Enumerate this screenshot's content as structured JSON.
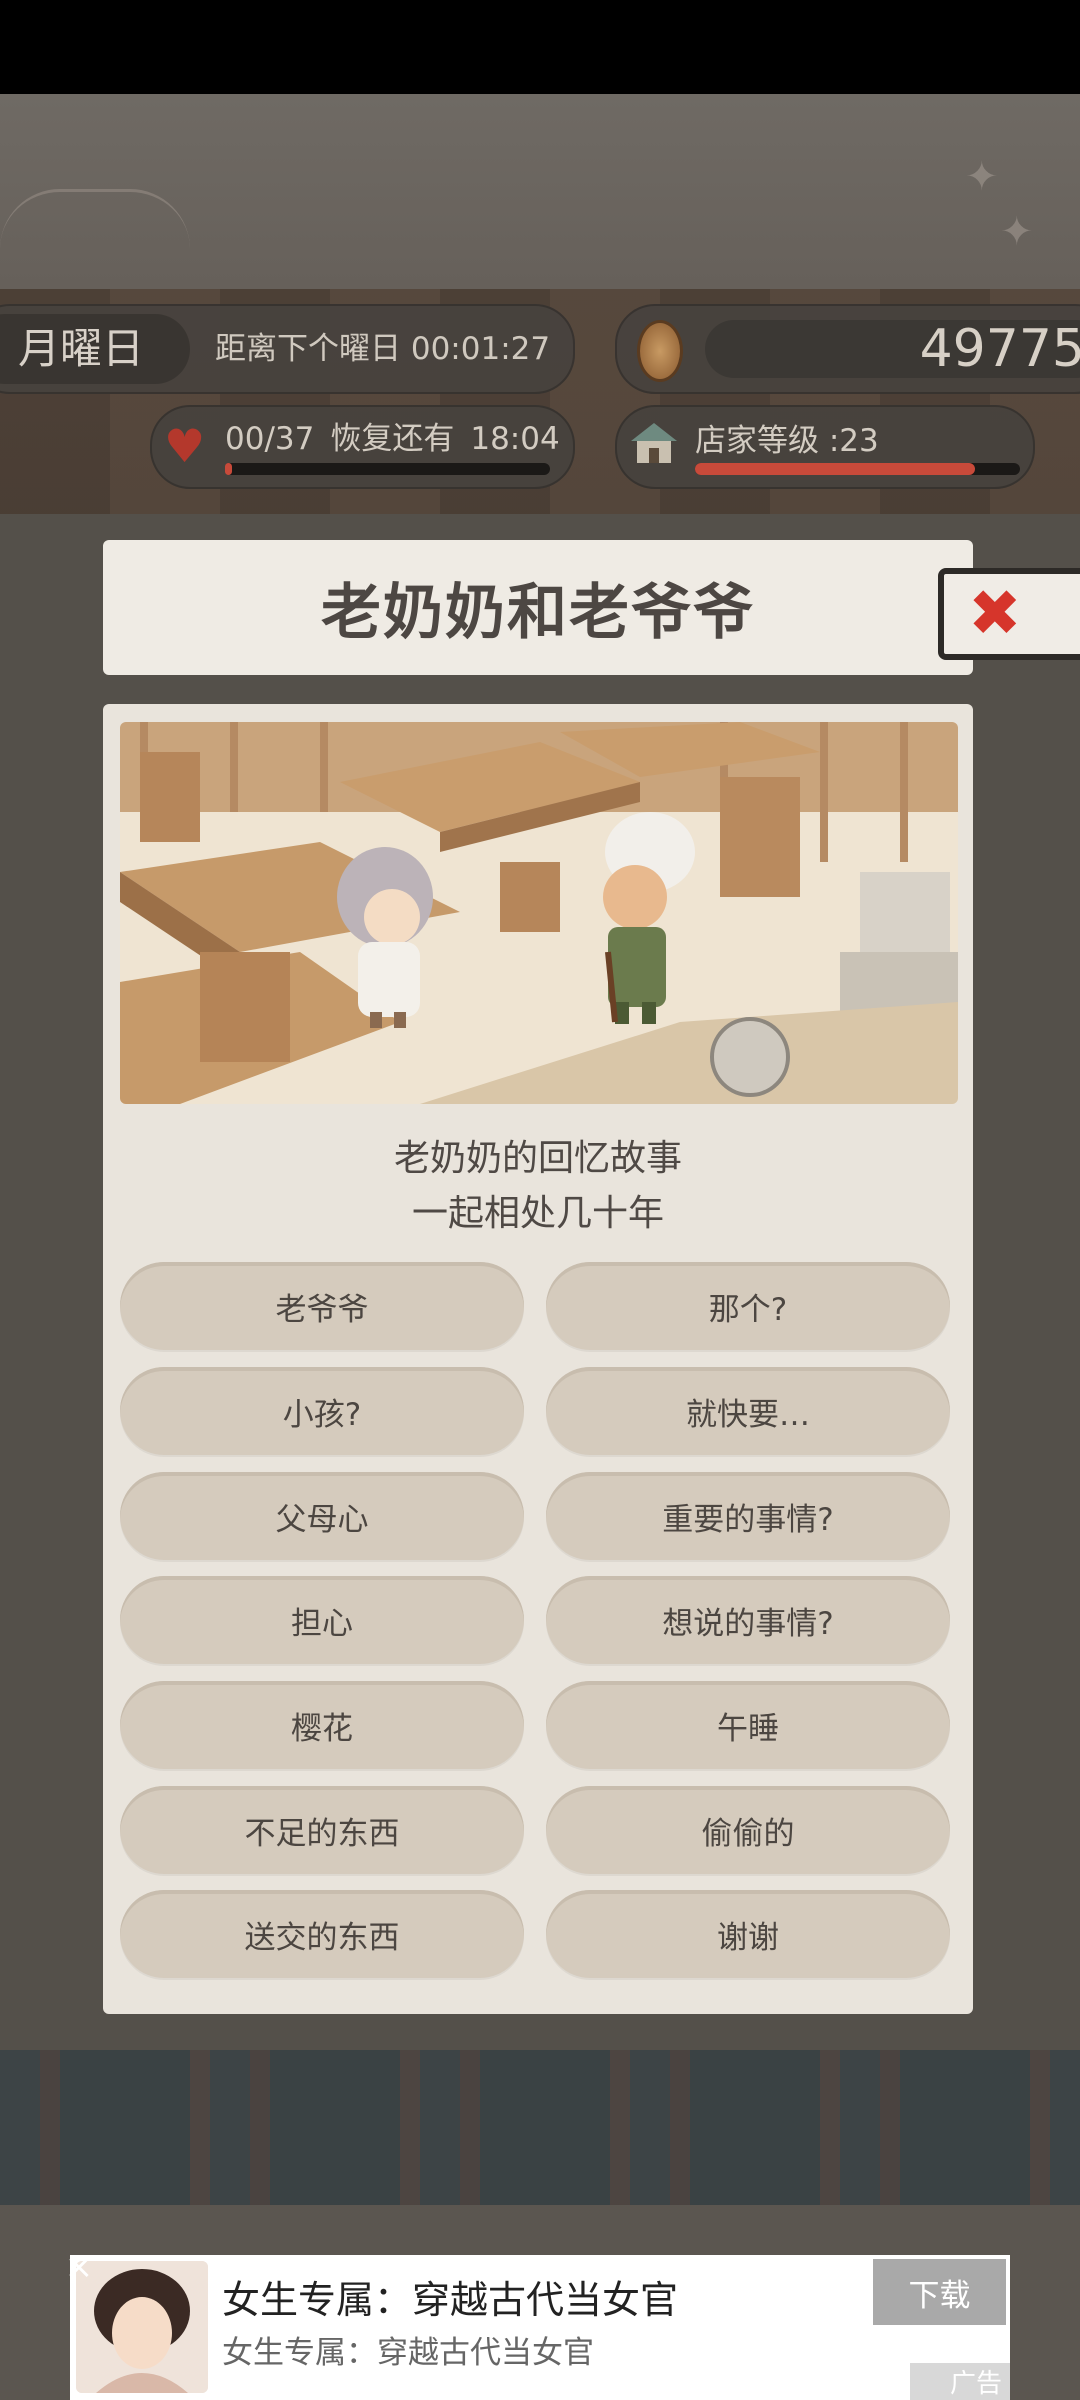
{
  "hud": {
    "day_label": "月曜日",
    "countdown": "距离下个曜日 00:01:27",
    "coins": "49775",
    "stamina": "00/37",
    "recover_text": "恢复还有",
    "recover_time": "18:04",
    "stamina_fill": 0.02,
    "shop_level": "店家等级 :23",
    "level_progress": 0.86
  },
  "dialog": {
    "title": "老奶奶和老爷爷",
    "story_line1": "老奶奶的回忆故事",
    "story_line2": "一起相处几十年",
    "choices": [
      "老爷爷",
      "那个?",
      "小孩?",
      "就快要…",
      "父母心",
      "重要的事情?",
      "担心",
      "想说的事情?",
      "樱花",
      "午睡",
      "不足的东西",
      "偷偷的",
      "送交的东西",
      "谢谢"
    ]
  },
  "ad": {
    "title": "女生专属：穿越古代当女官",
    "subtitle": "女生专属：穿越古代当女官",
    "button": "下载",
    "tag": "广告"
  },
  "icons": {
    "close": "close-icon",
    "coin": "coin-icon",
    "heart": "heart-icon",
    "shop": "house-icon"
  }
}
